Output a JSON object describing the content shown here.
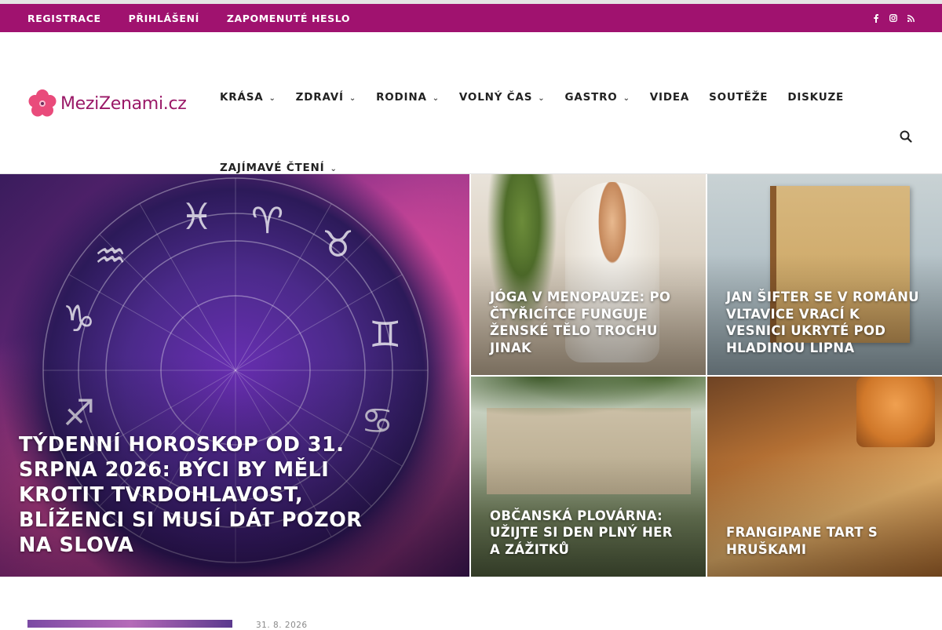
{
  "topbar": {
    "links": [
      "REGISTRACE",
      "PŘIHLÁŠENÍ",
      "ZAPOMENUTÉ HESLO"
    ],
    "social": [
      "facebook-icon",
      "instagram-icon",
      "rss-icon"
    ],
    "color": "#a0126f"
  },
  "logo": {
    "text_main": "MeziZenami",
    "text_suffix": ".cz",
    "color": "#9a1867",
    "flower_color": "#e94b7b"
  },
  "nav": {
    "row1": [
      {
        "label": "KRÁSA",
        "dropdown": true
      },
      {
        "label": "ZDRAVÍ",
        "dropdown": true
      },
      {
        "label": "RODINA",
        "dropdown": true
      },
      {
        "label": "VOLNÝ ČAS",
        "dropdown": true
      },
      {
        "label": "GASTRO",
        "dropdown": true
      },
      {
        "label": "VIDEA",
        "dropdown": false
      },
      {
        "label": "SOUTĚŽE",
        "dropdown": false
      },
      {
        "label": "DISKUZE",
        "dropdown": false
      }
    ],
    "row2": [
      {
        "label": "ZAJÍMAVÉ ČTENÍ",
        "dropdown": true
      }
    ],
    "search_icon": "search-icon"
  },
  "hero": {
    "main": {
      "title": "TÝDENNÍ HOROSKOP OD 31. SRPNA 2026: BÝCI BY MĚLI KROTIT TVRDOHLAVOST, BLÍŽENCI SI MUSÍ DÁT POZOR NA SLOVA"
    },
    "cards": [
      {
        "title": "JÓGA V MENOPAUZE: PO ČTYŘICÍTCE FUNGUJE ŽENSKÉ TĚLO TROCHU JINAK"
      },
      {
        "title": "JAN ŠIFTER SE V ROMÁNU VLTAVICE VRACÍ K VESNICI UKRYTÉ POD HLADINOU LIPNA"
      },
      {
        "title": "OBČANSKÁ PLOVÁRNA: UŽIJTE SI DEN PLNÝ HER A ZÁŽITKŮ"
      },
      {
        "title": "FRANGIPANE TART S HRUŠKAMI"
      }
    ]
  },
  "teaser": {
    "date": "31. 8. 2026"
  }
}
